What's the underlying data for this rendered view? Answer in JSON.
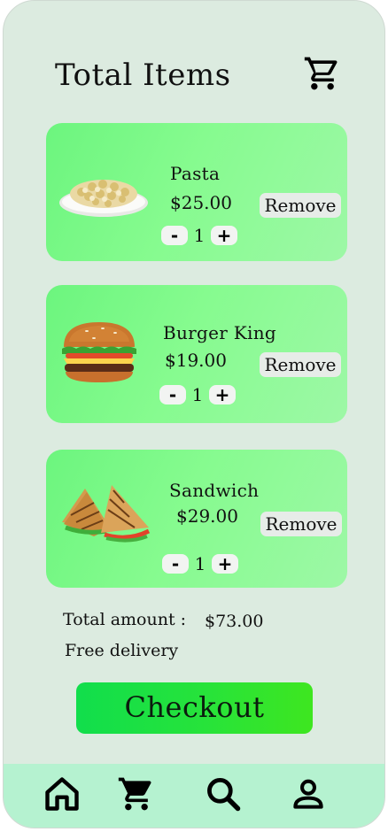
{
  "header": {
    "title": "Total Items",
    "cart_icon": "cart-icon"
  },
  "items": [
    {
      "name": "Pasta",
      "price": "$25.00",
      "quantity": "1",
      "remove_label": "Remove",
      "minus_label": "-",
      "plus_label": "+",
      "image": "pasta-image"
    },
    {
      "name": "Burger King",
      "price": "$19.00",
      "quantity": "1",
      "remove_label": "Remove",
      "minus_label": "-",
      "plus_label": "+",
      "image": "burger-image"
    },
    {
      "name": "Sandwich",
      "price": "$29.00",
      "quantity": "1",
      "remove_label": "Remove",
      "minus_label": "-",
      "plus_label": "+",
      "image": "sandwich-image"
    }
  ],
  "summary": {
    "total_label": "Total amount :",
    "total_value": "$73.00",
    "delivery": "Free delivery"
  },
  "checkout_label": "Checkout",
  "nav": [
    {
      "icon": "home-icon"
    },
    {
      "icon": "cart-icon"
    },
    {
      "icon": "search-icon"
    },
    {
      "icon": "profile-icon"
    }
  ],
  "colors": {
    "background": "#dcebe0",
    "card": "#86fb8f",
    "checkout": "#27e33a",
    "nav": "#b5f2d0"
  }
}
